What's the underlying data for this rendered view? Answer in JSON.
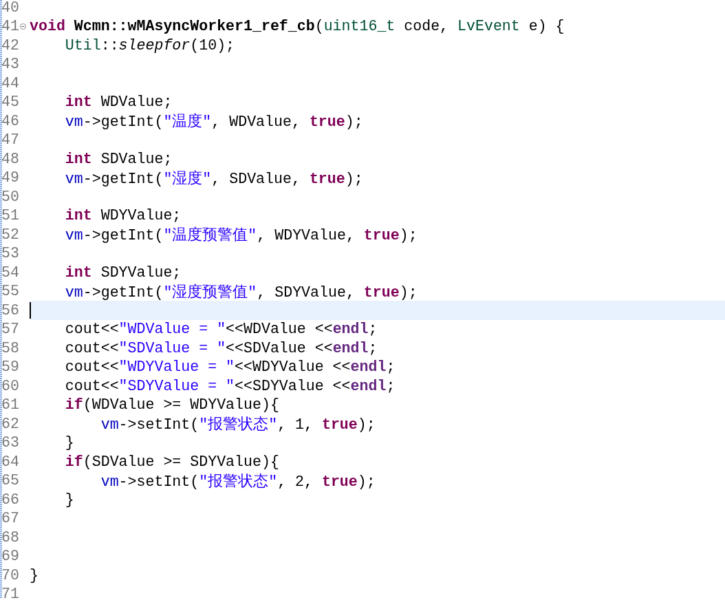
{
  "editor": {
    "lines": [
      {
        "number": "40"
      },
      {
        "number": "41",
        "foldable": true,
        "tokens": [
          {
            "kind": "keyword",
            "text": "void"
          },
          {
            "kind": "function",
            "text": " Wcmn::wMAsyncWorker1_ref_cb"
          },
          {
            "kind": "plain",
            "text": "("
          },
          {
            "kind": "type",
            "text": "uint16_t"
          },
          {
            "kind": "plain",
            "text": " code, "
          },
          {
            "kind": "type",
            "text": "LvEvent"
          },
          {
            "kind": "plain",
            "text": " e) {"
          }
        ]
      },
      {
        "number": "42",
        "tokens": [
          {
            "kind": "type",
            "text": "    Util"
          },
          {
            "kind": "plain",
            "text": "::"
          },
          {
            "kind": "italic",
            "text": "sleepfor"
          },
          {
            "kind": "plain",
            "text": "(10);"
          }
        ]
      },
      {
        "number": "43"
      },
      {
        "number": "44"
      },
      {
        "number": "45",
        "tokens": [
          {
            "kind": "keyword",
            "text": "    int"
          },
          {
            "kind": "plain",
            "text": " WDValue;"
          }
        ]
      },
      {
        "number": "46",
        "tokens": [
          {
            "kind": "field",
            "text": "    vm"
          },
          {
            "kind": "plain",
            "text": "->getInt("
          },
          {
            "kind": "string",
            "text": "\"温度\""
          },
          {
            "kind": "plain",
            "text": ", WDValue, "
          },
          {
            "kind": "keyword",
            "text": "true"
          },
          {
            "kind": "plain",
            "text": ");"
          }
        ]
      },
      {
        "number": "47"
      },
      {
        "number": "48",
        "tokens": [
          {
            "kind": "keyword",
            "text": "    int"
          },
          {
            "kind": "plain",
            "text": " SDValue;"
          }
        ]
      },
      {
        "number": "49",
        "tokens": [
          {
            "kind": "field",
            "text": "    vm"
          },
          {
            "kind": "plain",
            "text": "->getInt("
          },
          {
            "kind": "string",
            "text": "\"湿度\""
          },
          {
            "kind": "plain",
            "text": ", SDValue, "
          },
          {
            "kind": "keyword",
            "text": "true"
          },
          {
            "kind": "plain",
            "text": ");"
          }
        ]
      },
      {
        "number": "50"
      },
      {
        "number": "51",
        "tokens": [
          {
            "kind": "keyword",
            "text": "    int"
          },
          {
            "kind": "plain",
            "text": " WDYValue;"
          }
        ]
      },
      {
        "number": "52",
        "tokens": [
          {
            "kind": "field",
            "text": "    vm"
          },
          {
            "kind": "plain",
            "text": "->getInt("
          },
          {
            "kind": "string",
            "text": "\"温度预警值\""
          },
          {
            "kind": "plain",
            "text": ", WDYValue, "
          },
          {
            "kind": "keyword",
            "text": "true"
          },
          {
            "kind": "plain",
            "text": ");"
          }
        ]
      },
      {
        "number": "53"
      },
      {
        "number": "54",
        "tokens": [
          {
            "kind": "keyword",
            "text": "    int"
          },
          {
            "kind": "plain",
            "text": " SDYValue;"
          }
        ]
      },
      {
        "number": "55",
        "tokens": [
          {
            "kind": "field",
            "text": "    vm"
          },
          {
            "kind": "plain",
            "text": "->getInt("
          },
          {
            "kind": "string",
            "text": "\"湿度预警值\""
          },
          {
            "kind": "plain",
            "text": ", SDYValue, "
          },
          {
            "kind": "keyword",
            "text": "true"
          },
          {
            "kind": "plain",
            "text": ");"
          }
        ]
      },
      {
        "number": "56",
        "current": true
      },
      {
        "number": "57",
        "tokens": [
          {
            "kind": "plain",
            "text": "    cout<<"
          },
          {
            "kind": "string",
            "text": "\"WDValue = \""
          },
          {
            "kind": "plain",
            "text": "<<WDValue <<"
          },
          {
            "kind": "macro",
            "text": "endl"
          },
          {
            "kind": "plain",
            "text": ";"
          }
        ]
      },
      {
        "number": "58",
        "tokens": [
          {
            "kind": "plain",
            "text": "    cout<<"
          },
          {
            "kind": "string",
            "text": "\"SDValue = \""
          },
          {
            "kind": "plain",
            "text": "<<SDValue <<"
          },
          {
            "kind": "macro",
            "text": "endl"
          },
          {
            "kind": "plain",
            "text": ";"
          }
        ]
      },
      {
        "number": "59",
        "tokens": [
          {
            "kind": "plain",
            "text": "    cout<<"
          },
          {
            "kind": "string",
            "text": "\"WDYValue = \""
          },
          {
            "kind": "plain",
            "text": "<<WDYValue <<"
          },
          {
            "kind": "macro",
            "text": "endl"
          },
          {
            "kind": "plain",
            "text": ";"
          }
        ]
      },
      {
        "number": "60",
        "tokens": [
          {
            "kind": "plain",
            "text": "    cout<<"
          },
          {
            "kind": "string",
            "text": "\"SDYValue = \""
          },
          {
            "kind": "plain",
            "text": "<<SDYValue <<"
          },
          {
            "kind": "macro",
            "text": "endl"
          },
          {
            "kind": "plain",
            "text": ";"
          }
        ]
      },
      {
        "number": "61",
        "tokens": [
          {
            "kind": "keyword",
            "text": "    if"
          },
          {
            "kind": "plain",
            "text": "(WDValue >= WDYValue){"
          }
        ]
      },
      {
        "number": "62",
        "tokens": [
          {
            "kind": "field",
            "text": "        vm"
          },
          {
            "kind": "plain",
            "text": "->setInt("
          },
          {
            "kind": "string",
            "text": "\"报警状态\""
          },
          {
            "kind": "plain",
            "text": ", 1, "
          },
          {
            "kind": "keyword",
            "text": "true"
          },
          {
            "kind": "plain",
            "text": ");"
          }
        ]
      },
      {
        "number": "63",
        "tokens": [
          {
            "kind": "plain",
            "text": "    }"
          }
        ]
      },
      {
        "number": "64",
        "tokens": [
          {
            "kind": "keyword",
            "text": "    if"
          },
          {
            "kind": "plain",
            "text": "(SDValue >= SDYValue){"
          }
        ]
      },
      {
        "number": "65",
        "tokens": [
          {
            "kind": "field",
            "text": "        vm"
          },
          {
            "kind": "plain",
            "text": "->setInt("
          },
          {
            "kind": "string",
            "text": "\"报警状态\""
          },
          {
            "kind": "plain",
            "text": ", 2, "
          },
          {
            "kind": "keyword",
            "text": "true"
          },
          {
            "kind": "plain",
            "text": ");"
          }
        ]
      },
      {
        "number": "66",
        "tokens": [
          {
            "kind": "plain",
            "text": "    }"
          }
        ]
      },
      {
        "number": "67"
      },
      {
        "number": "68"
      },
      {
        "number": "69"
      },
      {
        "number": "70",
        "tokens": [
          {
            "kind": "plain",
            "text": "}"
          }
        ]
      },
      {
        "number": "71"
      }
    ]
  }
}
